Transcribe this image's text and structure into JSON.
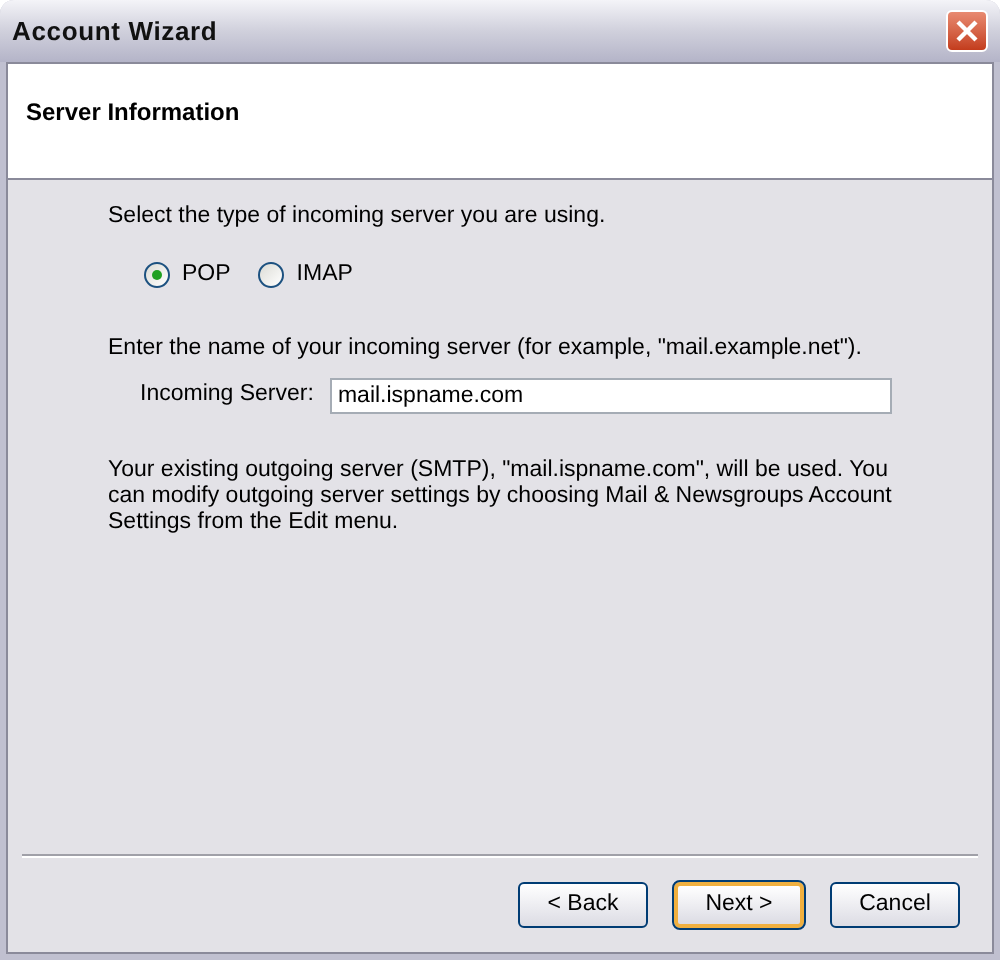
{
  "window": {
    "title": "Account Wizard"
  },
  "header": {
    "title": "Server Information"
  },
  "server_type": {
    "prompt": "Select the type of incoming server you are using.",
    "options": [
      {
        "label": "POP",
        "selected": true
      },
      {
        "label": "IMAP",
        "selected": false
      }
    ]
  },
  "server_name": {
    "prompt": "Enter the name of your incoming server (for example, \"mail.example.net\").",
    "label": "Incoming Server:",
    "value": "mail.ispname.com"
  },
  "note": "Your existing outgoing server (SMTP), \"mail.ispname.com\", will be used. You can modify outgoing server settings by choosing Mail & Newsgroups Account Settings from the Edit menu.",
  "buttons": [
    {
      "label": "< Back",
      "default": false
    },
    {
      "label": "Next >",
      "default": true
    },
    {
      "label": "Cancel",
      "default": false
    }
  ]
}
